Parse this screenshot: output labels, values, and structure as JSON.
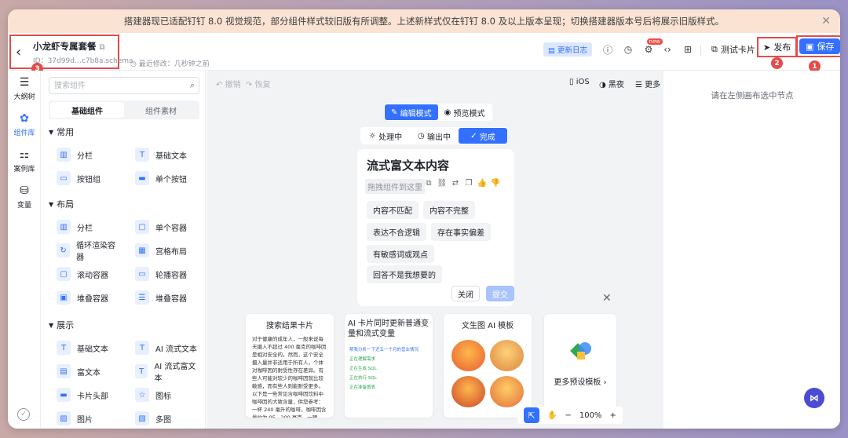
{
  "notice": {
    "text": "搭建器现已适配钉钉 8.0 视觉规范，部分组件样式较旧版有所调整。上述新样式仅在钉钉 8.0 及以上版本呈现；切换搭建器版本号后将展示旧版样式。"
  },
  "header": {
    "app_name": "小龙虾专属套餐",
    "app_id": "ID：37d99d…c7b8a.schema",
    "last_modified": "最近修改：几秒钟之前",
    "update_log": "更新日志",
    "new_tag": "new",
    "test_card": "测试卡片",
    "publish": "发布",
    "save": "保存",
    "markers": {
      "save": "1",
      "publish": "2",
      "back": "3"
    }
  },
  "rail": {
    "items": [
      {
        "label": "大纲树",
        "icon": "outline-icon"
      },
      {
        "label": "组件库",
        "icon": "components-icon"
      },
      {
        "label": "案例库",
        "icon": "cases-icon"
      },
      {
        "label": "变量",
        "icon": "variables-icon"
      }
    ],
    "active": "组件库"
  },
  "panel": {
    "search_placeholder": "搜索组件",
    "tabs": [
      "基础组件",
      "组件素材"
    ],
    "active_tab": "基础组件",
    "sections": [
      {
        "title": "常用",
        "items": [
          "分栏",
          "基础文本",
          "按钮组",
          "单个按钮"
        ]
      },
      {
        "title": "布局",
        "items": [
          "分栏",
          "单个容器",
          "循环渲染容器",
          "宫格布局",
          "滚动容器",
          "轮播容器",
          "堆叠容器",
          "堆叠容器"
        ]
      },
      {
        "title": "展示",
        "items": [
          "基础文本",
          "AI 流式文本",
          "富文本",
          "AI 流式富文本",
          "卡片头部",
          "图标",
          "图片",
          "多图"
        ]
      }
    ]
  },
  "canvas": {
    "undo": "撤销",
    "redo": "恢复",
    "ios": "iOS",
    "dark": "黑夜",
    "more": "更多",
    "modes": [
      "编辑模式",
      "预览模式"
    ],
    "active_mode": "编辑模式",
    "states": [
      "处理中",
      "输出中",
      "完成"
    ],
    "active_state": "完成",
    "card": {
      "title": "流式富文本内容",
      "drag_hint": "拖拽组件到这里",
      "chips": [
        "内容不匹配",
        "内容不完整",
        "表达不合逻辑",
        "存在事实偏差",
        "有敏感词或观点",
        "回答不是我想要的"
      ],
      "close": "关闭",
      "submit": "提交"
    },
    "templates": [
      {
        "title": "搜索结果卡片",
        "text": "对于健康的成年人，一般来说每天摄入不超过 400 毫克的咖啡因是相对安全的。然而，这个安全摄入量并非适用于所有人，个体对咖啡因的耐受性存在差异。有些人可能对较少的咖啡因就比较敏感，而有些人则能耐受更多。以下是一些常见含咖啡因饮料中咖啡因的大致含量，供您参考：一杯 240 毫升的咖啡，咖啡因含量约为 95 - 200 毫克，一罐 330"
      },
      {
        "title": "AI 卡片同时更新普通变量和流式变量",
        "rows": [
          "帮我分析一下近五一个月的营业情况",
          "正在理解需求",
          "正在生成 SQL",
          "正在执行 SQL",
          "正在准备图表"
        ]
      },
      {
        "title": "文生图 AI 模板"
      }
    ],
    "more_templates": "更多预设模板",
    "zoom": "100%"
  },
  "right": {
    "hint": "请在左侧画布选中节点"
  },
  "colors": {
    "accent": "#3370ff",
    "marker": "#e64a4a"
  }
}
